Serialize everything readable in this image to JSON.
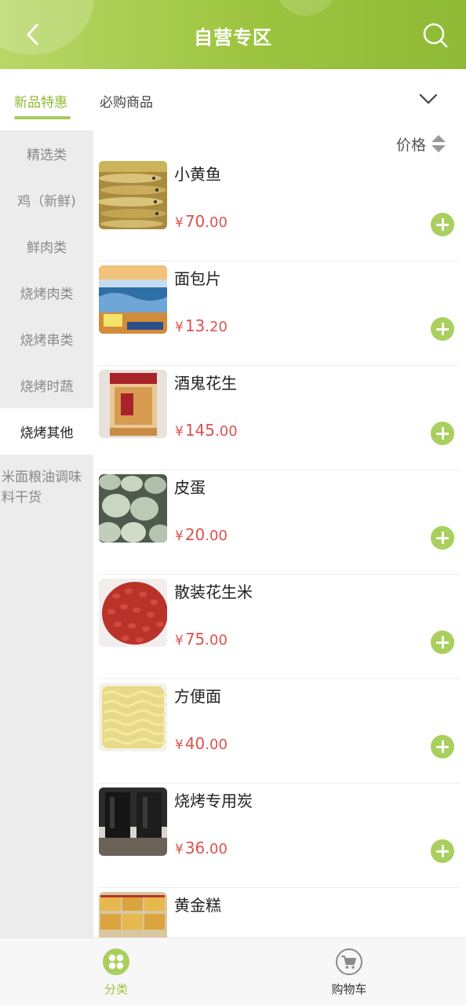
{
  "header": {
    "title": "自营专区",
    "back_icon": "chevron-left-icon",
    "search_icon": "search-icon"
  },
  "tabs": [
    {
      "label": "新品特惠",
      "active": true
    },
    {
      "label": "必购商品",
      "active": false
    }
  ],
  "categories": [
    {
      "label": "精选类"
    },
    {
      "label": "鸡（新鲜)"
    },
    {
      "label": "鲜肉类"
    },
    {
      "label": "烧烤肉类"
    },
    {
      "label": "烧烤串类"
    },
    {
      "label": "烧烤时蔬"
    },
    {
      "label": "烧烤其他",
      "active": true
    },
    {
      "label": "米面粮油调味料干货"
    }
  ],
  "sort": {
    "label": "价格"
  },
  "products": [
    {
      "name": "小黄鱼",
      "currency": "¥",
      "price_int": "70",
      "price_dec": ".00"
    },
    {
      "name": "面包片",
      "currency": "¥",
      "price_int": "13",
      "price_dec": ".20"
    },
    {
      "name": "酒鬼花生",
      "currency": "¥",
      "price_int": "145",
      "price_dec": ".00"
    },
    {
      "name": "皮蛋",
      "currency": "¥",
      "price_int": "20",
      "price_dec": ".00"
    },
    {
      "name": "散装花生米",
      "currency": "¥",
      "price_int": "75",
      "price_dec": ".00"
    },
    {
      "name": "方便面",
      "currency": "¥",
      "price_int": "40",
      "price_dec": ".00"
    },
    {
      "name": "烧烤专用炭",
      "currency": "¥",
      "price_int": "36",
      "price_dec": ".00"
    },
    {
      "name": "黄金糕",
      "currency": "",
      "price_int": "",
      "price_dec": ""
    }
  ],
  "bottom_nav": [
    {
      "label": "分类",
      "icon": "category-grid-icon",
      "active": true
    },
    {
      "label": "购物车",
      "icon": "shopping-cart-icon",
      "active": false
    }
  ],
  "colors": {
    "accent": "#9cc43f",
    "price": "#d9534f",
    "sidebar_bg": "#ececec"
  }
}
